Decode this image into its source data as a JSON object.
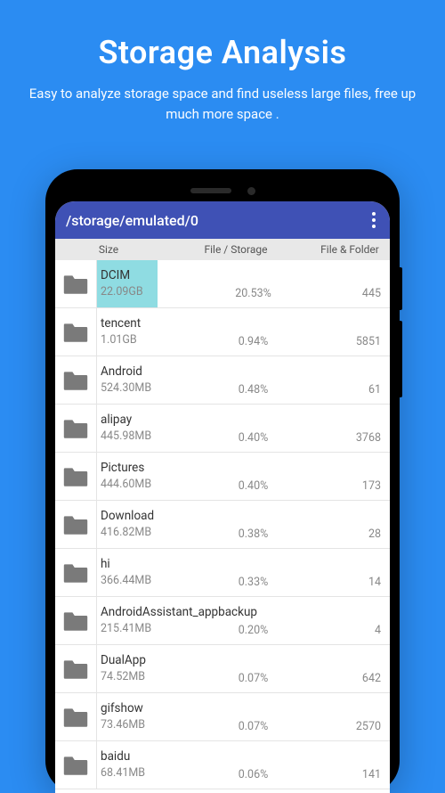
{
  "hero": {
    "title": "Storage Analysis",
    "subtitle": "Easy to analyze storage space and find useless large files, free up much more space ."
  },
  "appbar": {
    "path": "/storage/emulated/0"
  },
  "columns": {
    "size": "Size",
    "file_storage": "File / Storage",
    "file_folder": "File & Folder"
  },
  "items": [
    {
      "name": "DCIM",
      "size": "22.09GB",
      "pct": "20.53%",
      "count": "445",
      "hl": 68
    },
    {
      "name": "tencent",
      "size": "1.01GB",
      "pct": "0.94%",
      "count": "5851",
      "hl": 0
    },
    {
      "name": "Android",
      "size": "524.30MB",
      "pct": "0.48%",
      "count": "61",
      "hl": 0
    },
    {
      "name": "alipay",
      "size": "445.98MB",
      "pct": "0.40%",
      "count": "3768",
      "hl": 0
    },
    {
      "name": "Pictures",
      "size": "444.60MB",
      "pct": "0.40%",
      "count": "173",
      "hl": 0
    },
    {
      "name": "Download",
      "size": "416.82MB",
      "pct": "0.38%",
      "count": "28",
      "hl": 0
    },
    {
      "name": "hi",
      "size": "366.44MB",
      "pct": "0.33%",
      "count": "14",
      "hl": 0
    },
    {
      "name": "AndroidAssistant_appbackup",
      "size": "215.41MB",
      "pct": "0.20%",
      "count": "4",
      "hl": 0
    },
    {
      "name": "DualApp",
      "size": "74.52MB",
      "pct": "0.07%",
      "count": "642",
      "hl": 0
    },
    {
      "name": "gifshow",
      "size": "73.46MB",
      "pct": "0.07%",
      "count": "2570",
      "hl": 0
    },
    {
      "name": "baidu",
      "size": "68.41MB",
      "pct": "0.06%",
      "count": "141",
      "hl": 0
    }
  ]
}
